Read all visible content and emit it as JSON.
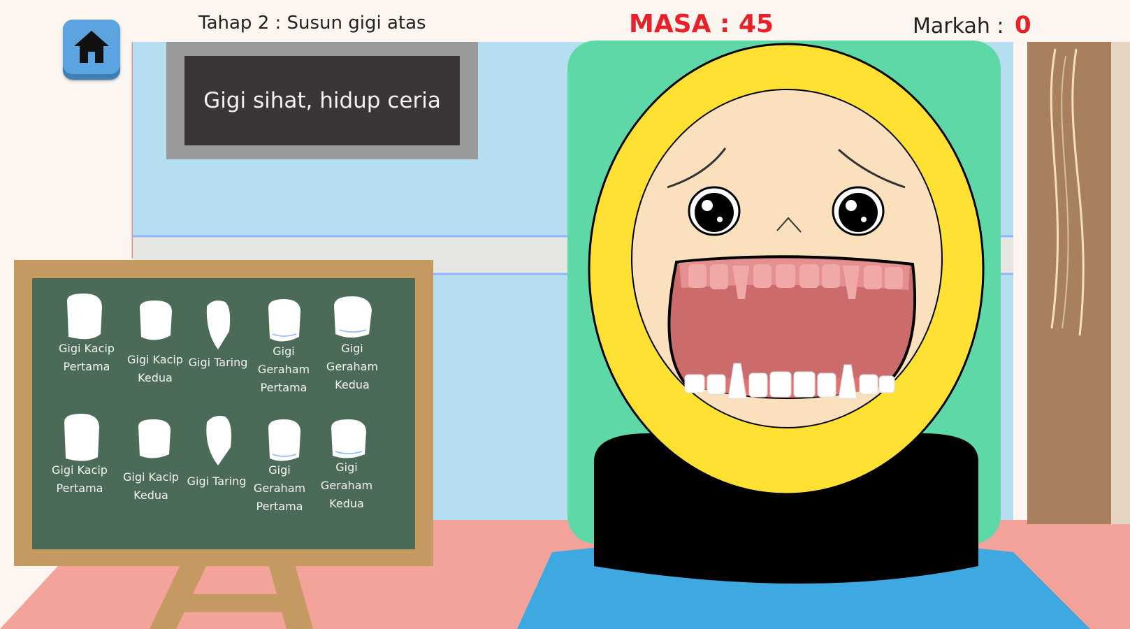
{
  "hud": {
    "level_label": "Tahap 2 : Susun gigi atas",
    "timer_label": "MASA : 45",
    "score_label": "Markah :",
    "score_value": "0"
  },
  "icons": {
    "home_button": "home-icon"
  },
  "sign": {
    "text": "Gigi sihat, hidup ceria"
  },
  "tooth_board": {
    "rows": [
      [
        {
          "label": "Gigi Kacip Pertama"
        },
        {
          "label": "Gigi Kacip Kedua"
        },
        {
          "label": "Gigi Taring"
        },
        {
          "label": "Gigi Geraham Pertama"
        },
        {
          "label": "Gigi Geraham Kedua"
        }
      ],
      [
        {
          "label": "Gigi Kacip Pertama"
        },
        {
          "label": "Gigi Kacip Kedua"
        },
        {
          "label": "Gigi Taring"
        },
        {
          "label": "Gigi Geraham Pertama"
        },
        {
          "label": "Gigi Geraham Kedua"
        }
      ]
    ]
  },
  "colors": {
    "timer": "#e8202a",
    "score": "#e8202a",
    "home_button": "#5ba4e0",
    "chalkboard": "#4b6a58",
    "board_frame": "#c49a62",
    "hijab": "#ffe133",
    "chair": "#5fd8a8",
    "shirt": "#3ea9e0",
    "floor": "#f4a39a",
    "wall": "#b5def0"
  }
}
